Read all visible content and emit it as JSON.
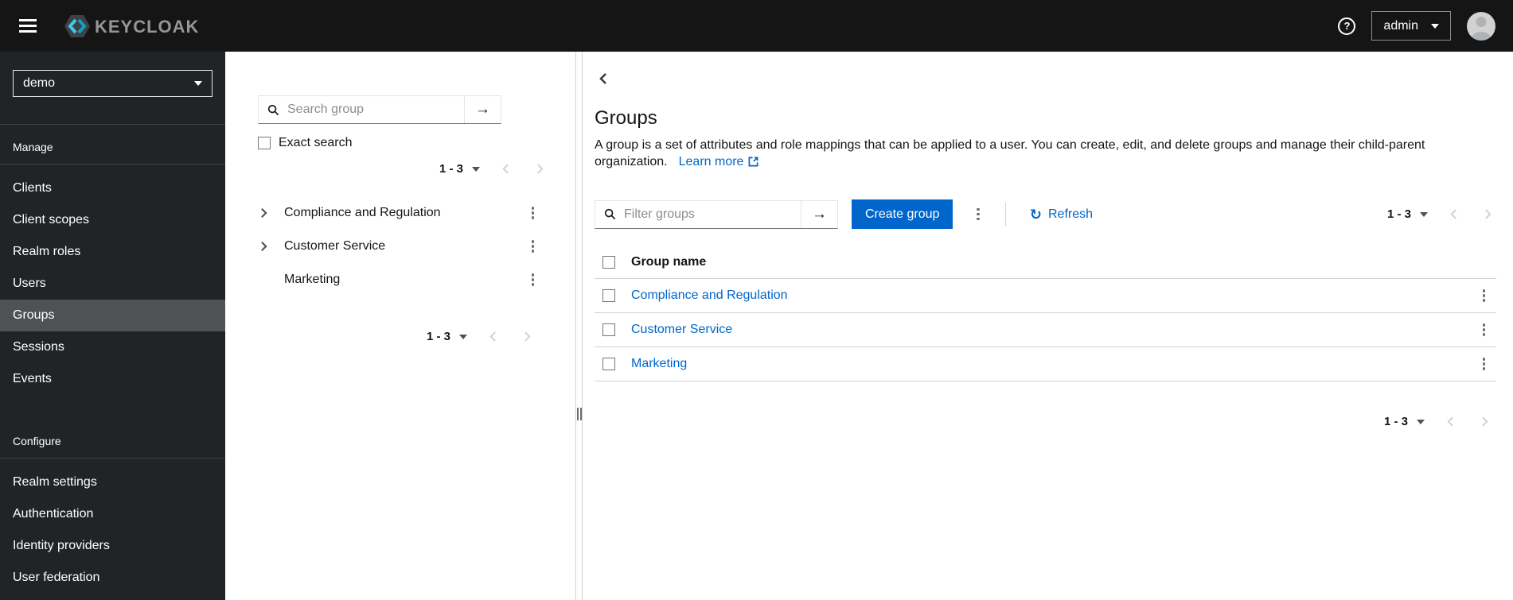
{
  "topbar": {
    "brand": "KEYCLOAK",
    "help_icon": "?",
    "user_menu": {
      "label": "admin"
    }
  },
  "sidebar": {
    "realm_selector": {
      "value": "demo"
    },
    "active_item": "Groups",
    "sections": [
      {
        "label": "Manage",
        "items": [
          "Clients",
          "Client scopes",
          "Realm roles",
          "Users",
          "Groups",
          "Sessions",
          "Events"
        ]
      },
      {
        "label": "Configure",
        "items": [
          "Realm settings",
          "Authentication",
          "Identity providers",
          "User federation"
        ]
      }
    ]
  },
  "group_tree_panel": {
    "search": {
      "placeholder": "Search group"
    },
    "exact_search_label": "Exact search",
    "top_pagination": {
      "range": "1 - 3"
    },
    "bottom_pagination": {
      "range": "1 - 3"
    },
    "items": [
      {
        "name": "Compliance and Regulation",
        "expandable": true
      },
      {
        "name": "Customer Service",
        "expandable": true
      },
      {
        "name": "Marketing",
        "expandable": false
      }
    ]
  },
  "main": {
    "title": "Groups",
    "description": "A group is a set of attributes and role mappings that can be applied to a user. You can create, edit, and delete groups and manage their child-parent organization.",
    "learn_more": "Learn more",
    "toolbar": {
      "filter": {
        "placeholder": "Filter groups"
      },
      "create_button": "Create group",
      "refresh_label": "Refresh",
      "pagination": {
        "range": "1 - 3"
      }
    },
    "table": {
      "header": "Group name",
      "rows": [
        {
          "name": "Compliance and Regulation"
        },
        {
          "name": "Customer Service"
        },
        {
          "name": "Marketing"
        }
      ]
    },
    "bottom_pagination": {
      "range": "1 - 3"
    }
  },
  "icons": {
    "arrow_right": "→",
    "refresh": "↻"
  },
  "colors": {
    "topbar_bg": "#151515",
    "sidebar_bg": "#212427",
    "sidebar_active_bg": "#4f5255",
    "accent": "#0066cc",
    "link": "#0066cc",
    "border": "#d2d2d2",
    "muted": "#6a6e73",
    "disabled": "#d2d2d2"
  }
}
